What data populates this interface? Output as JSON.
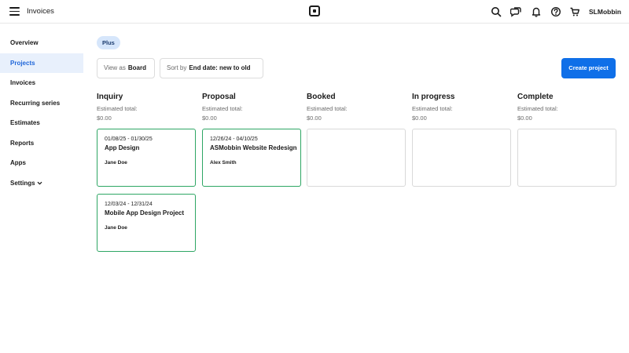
{
  "header": {
    "title": "Invoices",
    "user": "SLMobbin",
    "icons": [
      "search-icon",
      "chat-icon",
      "bell-icon",
      "help-icon",
      "cart-icon"
    ]
  },
  "sidebar": {
    "items": [
      {
        "label": "Overview"
      },
      {
        "label": "Projects",
        "active": true
      },
      {
        "label": "Invoices"
      },
      {
        "label": "Recurring series"
      },
      {
        "label": "Estimates"
      },
      {
        "label": "Reports"
      },
      {
        "label": "Apps"
      },
      {
        "label": "Settings"
      }
    ]
  },
  "toolbar": {
    "badge": "Plus",
    "view_label": "View as",
    "view_value": "Board",
    "sort_label": "Sort by",
    "sort_value": "End date: new to old",
    "create_label": "Create project"
  },
  "board": {
    "columns": [
      {
        "title": "Inquiry",
        "subtitle": "Estimated total:",
        "total": "$0.00",
        "cards": [
          {
            "dates": "01/08/25 - 01/30/25",
            "title": "App Design",
            "person": "Jane Doe"
          },
          {
            "dates": "12/03/24 - 12/31/24",
            "title": "Mobile App Design Project",
            "person": "Jane Doe"
          }
        ]
      },
      {
        "title": "Proposal",
        "subtitle": "Estimated total:",
        "total": "$0.00",
        "cards": [
          {
            "dates": "12/26/24 - 04/10/25",
            "title": "ASMobbin Website Redesign",
            "person": "Alex Smith"
          }
        ]
      },
      {
        "title": "Booked",
        "subtitle": "Estimated total:",
        "total": "$0.00",
        "cards": []
      },
      {
        "title": "In progress",
        "subtitle": "Estimated total:",
        "total": "$0.00",
        "cards": []
      },
      {
        "title": "Complete",
        "subtitle": "Estimated total:",
        "total": "$0.00",
        "cards": []
      }
    ]
  },
  "colors": {
    "accent": "#0f6fe8",
    "active_nav_bg": "#e8f0fc",
    "active_nav_text": "#1f66d9",
    "card_border": "#2ea664",
    "badge_bg": "#d6e6fb"
  }
}
